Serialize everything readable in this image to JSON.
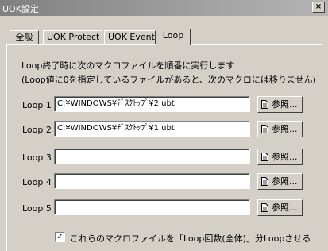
{
  "window": {
    "title": "UOK設定",
    "close_glyph": "×"
  },
  "tabs": [
    {
      "label": "全般"
    },
    {
      "label": "UOK Protect"
    },
    {
      "label": "UOK Event"
    },
    {
      "label": "Loop"
    }
  ],
  "panel": {
    "description_line1": "Loop終了時に次のマクロファイルを順番に実行します",
    "description_line2": "(Loop値に0を指定しているファイルがあると、次のマクロには移りません)",
    "loops": [
      {
        "label": "Loop 1",
        "value": "C:¥WINDOWS¥ﾃﾞｽｸﾄｯﾌﾟ¥2.ubt",
        "browse_label": "参照..."
      },
      {
        "label": "Loop 2",
        "value": "C:¥WINDOWS¥ﾃﾞｽｸﾄｯﾌﾟ¥1.ubt",
        "browse_label": "参照..."
      },
      {
        "label": "Loop 3",
        "value": "",
        "browse_label": "参照..."
      },
      {
        "label": "Loop 4",
        "value": "",
        "browse_label": "参照..."
      },
      {
        "label": "Loop 5",
        "value": "",
        "browse_label": "参照..."
      }
    ],
    "loop_checkbox": {
      "label": "これらのマクロファイルを「Loop回数(全体)」分Loopさせる",
      "checked": true,
      "check_glyph": "✓"
    }
  }
}
